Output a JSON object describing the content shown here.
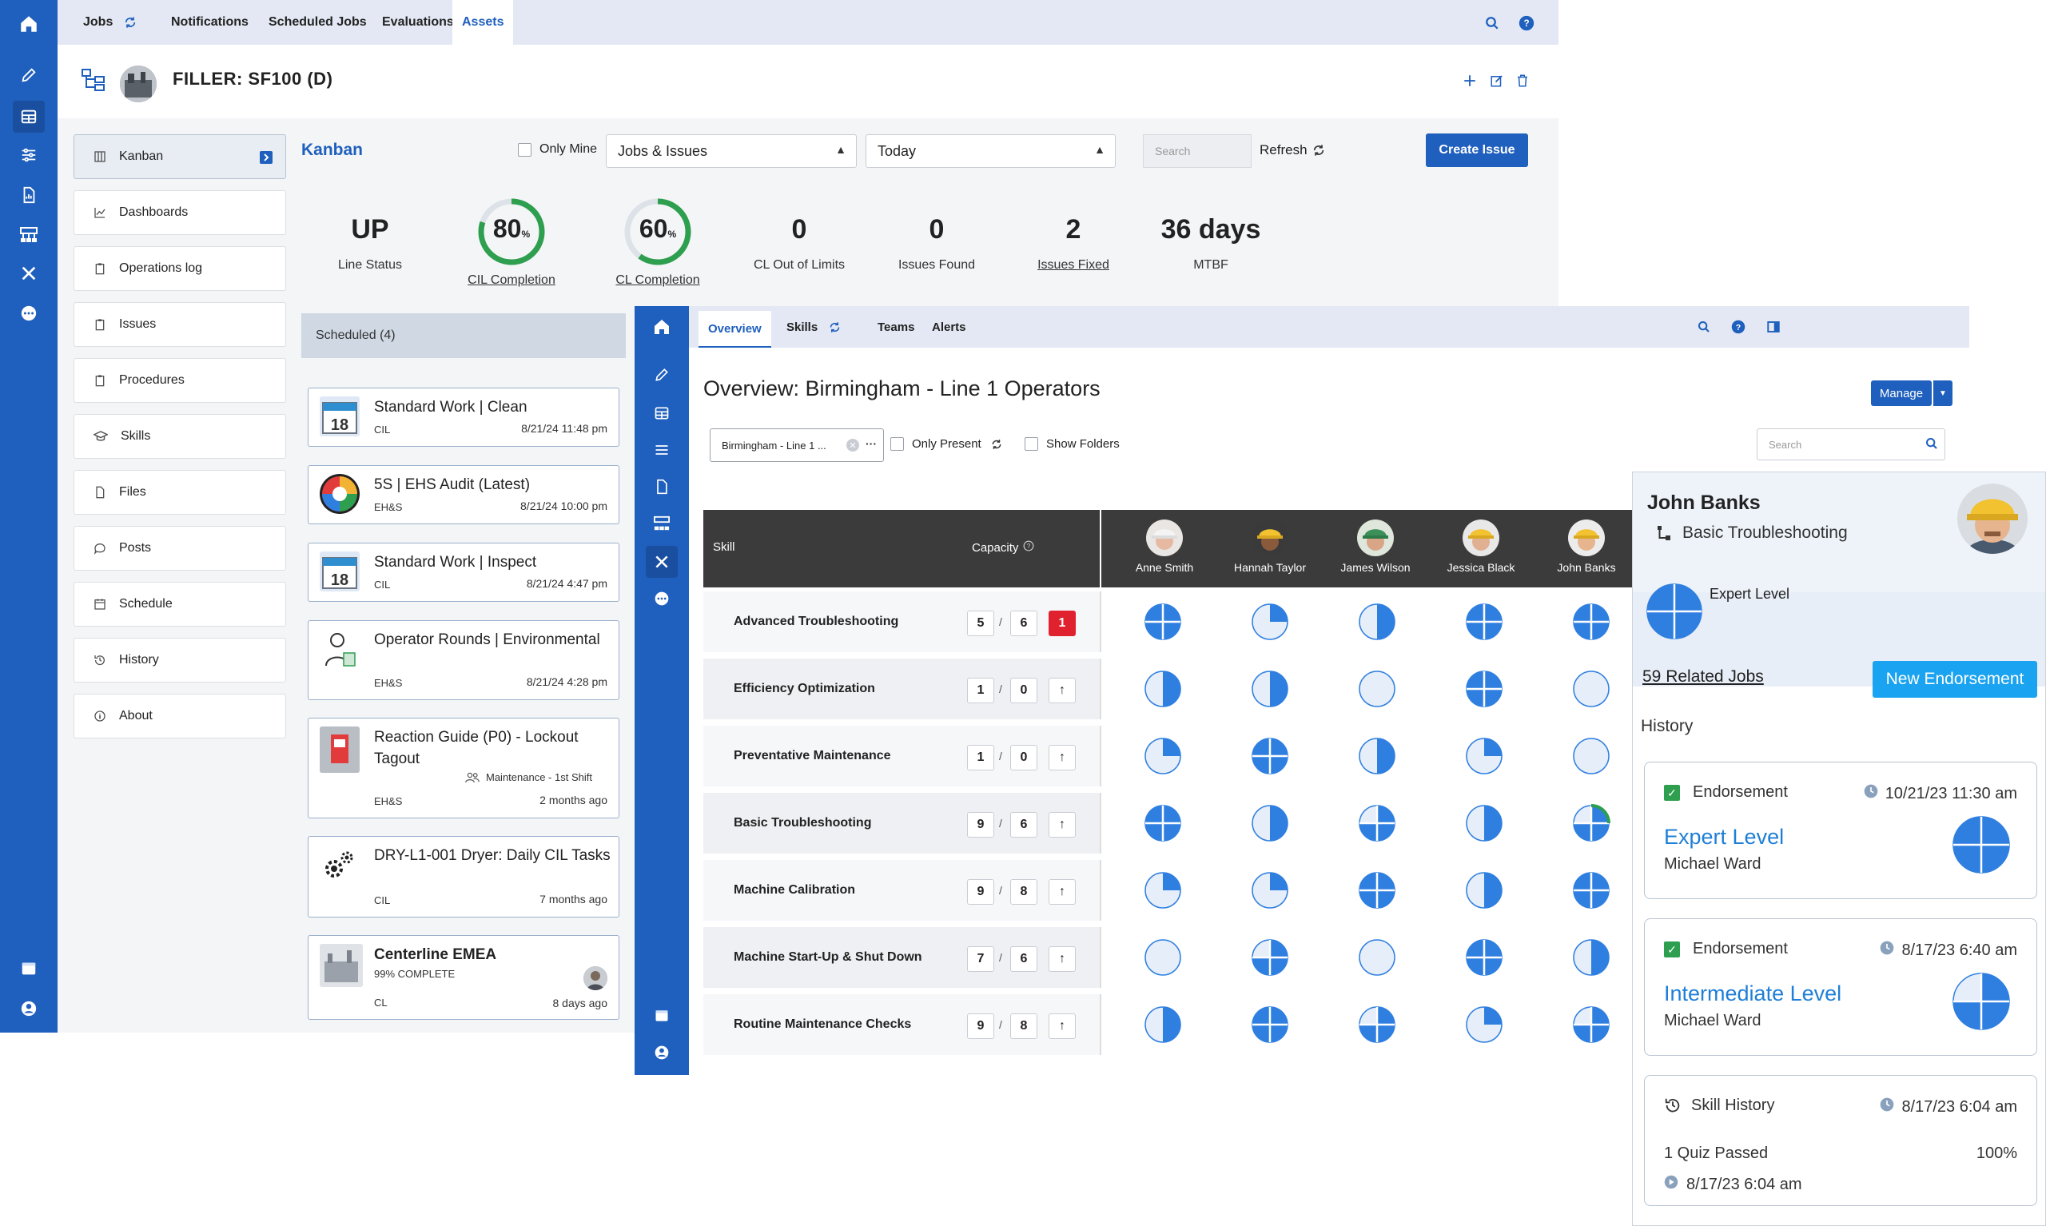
{
  "win1": {
    "tabs": [
      {
        "label": "Jobs"
      },
      {
        "label": "Notifications"
      },
      {
        "label": "Scheduled Jobs"
      },
      {
        "label": "Evaluations"
      },
      {
        "label": "Assets"
      }
    ],
    "asset_title": "FILLER: SF100 (D)",
    "nav": [
      "Kanban",
      "Dashboards",
      "Operations log",
      "Issues",
      "Procedures",
      "Skills",
      "Files",
      "Posts",
      "Schedule",
      "History",
      "About"
    ],
    "kanban": {
      "title": "Kanban",
      "only_mine": "Only Mine",
      "filter_select": "Jobs & Issues",
      "date_select": "Today",
      "search_placeholder": "Search",
      "refresh": "Refresh",
      "create_issue": "Create Issue"
    },
    "stats": [
      {
        "value": "UP",
        "label": "Line Status",
        "link": false
      },
      {
        "value": "80",
        "unit": "%",
        "label": "CIL Completion",
        "link": true,
        "percent": 80
      },
      {
        "value": "60",
        "unit": "%",
        "label": "CL Completion",
        "link": true,
        "percent": 60
      },
      {
        "value": "0",
        "label": "CL Out of Limits",
        "link": false
      },
      {
        "value": "0",
        "label": "Issues Found",
        "link": false
      },
      {
        "value": "2",
        "label": "Issues Fixed",
        "link": true
      },
      {
        "value": "36 days",
        "label": "MTBF",
        "link": false
      }
    ],
    "scheduled_header": "Scheduled (4)",
    "cards": [
      {
        "title": "Standard Work | Clean",
        "category": "CIL",
        "date": "8/21/24 11:48 pm",
        "thumb": "18"
      },
      {
        "title": "5S | EHS Audit (Latest)",
        "category": "EH&S",
        "date": "8/21/24 10:00 pm",
        "thumb": ""
      },
      {
        "title": "Standard Work | Inspect",
        "category": "CIL",
        "date": "8/21/24 4:47 pm",
        "thumb": "18"
      },
      {
        "title": "Operator Rounds | Environmental",
        "category": "EH&S",
        "date": "8/21/24 4:28 pm",
        "thumb": ""
      },
      {
        "title": "Reaction Guide (P0) - Lockout Tagout",
        "category": "EH&S",
        "date": "2 months ago",
        "extra": "Maintenance - 1st Shift",
        "thumb": ""
      },
      {
        "title": "DRY-L1-001 Dryer: Daily CIL Tasks",
        "category": "CIL",
        "date": "7 months ago",
        "thumb": ""
      },
      {
        "title": "Centerline EMEA",
        "category": "CL",
        "date": "8 days ago",
        "progress": "99% COMPLETE",
        "thumb": ""
      }
    ]
  },
  "win2": {
    "tabs": [
      {
        "label": "Overview"
      },
      {
        "label": "Skills"
      },
      {
        "label": "Teams"
      },
      {
        "label": "Alerts"
      }
    ],
    "title": "Overview: Birmingham - Line 1 Operators",
    "manage": "Manage",
    "folder_chip": "Birmingham - Line 1 ...",
    "only_present": "Only Present",
    "show_folders": "Show Folders",
    "search_placeholder": "Search",
    "col_skill": "Skill",
    "col_capacity": "Capacity",
    "people": [
      "Anne Smith",
      "Hannah Taylor",
      "James Wilson",
      "Jessica Black",
      "John Banks"
    ],
    "skills": [
      {
        "name": "Advanced Troubleshooting",
        "have": "5",
        "need": "6",
        "gap": "1",
        "levels": [
          4,
          1,
          2,
          4,
          4
        ]
      },
      {
        "name": "Efficiency Optimization",
        "have": "1",
        "need": "0",
        "gap": "",
        "levels": [
          2,
          2,
          0,
          4,
          0
        ]
      },
      {
        "name": "Preventative Maintenance",
        "have": "1",
        "need": "0",
        "gap": "",
        "levels": [
          1,
          4,
          2,
          1,
          0
        ]
      },
      {
        "name": "Basic Troubleshooting",
        "have": "9",
        "need": "6",
        "gap": "",
        "levels": [
          4,
          2,
          3,
          2,
          3
        ]
      },
      {
        "name": "Machine Calibration",
        "have": "9",
        "need": "8",
        "gap": "",
        "levels": [
          1,
          1,
          4,
          2,
          4
        ]
      },
      {
        "name": "Machine Start-Up & Shut Down",
        "have": "7",
        "need": "6",
        "gap": "",
        "levels": [
          0,
          3,
          0,
          4,
          2
        ]
      },
      {
        "name": "Routine Maintenance Checks",
        "have": "9",
        "need": "8",
        "gap": "",
        "levels": [
          2,
          4,
          3,
          1,
          3
        ]
      }
    ]
  },
  "panel": {
    "name": "John Banks",
    "skill": "Basic Troubleshooting",
    "level": "Expert Level",
    "related_jobs": "59 Related Jobs",
    "new_endorsement": "New Endorsement",
    "history_label": "History",
    "history": [
      {
        "type": "Endorsement",
        "date": "10/21/23 11:30 am",
        "level": "Expert Level",
        "by": "Michael Ward",
        "pie": 4
      },
      {
        "type": "Endorsement",
        "date": "8/17/23 6:40 am",
        "level": "Intermediate Level",
        "by": "Michael Ward",
        "pie": 3
      }
    ],
    "skill_history": {
      "type": "Skill History",
      "date": "8/17/23 6:04 am",
      "item": "1 Quiz Passed",
      "score": "100%",
      "item_date": "8/17/23 6:04 am"
    }
  },
  "colors": {
    "brand": "#1f5fbd",
    "accent": "#1aa3f0",
    "ring": "#2e9e4f",
    "pie": "#2f7fe0",
    "danger": "#e0212e"
  }
}
